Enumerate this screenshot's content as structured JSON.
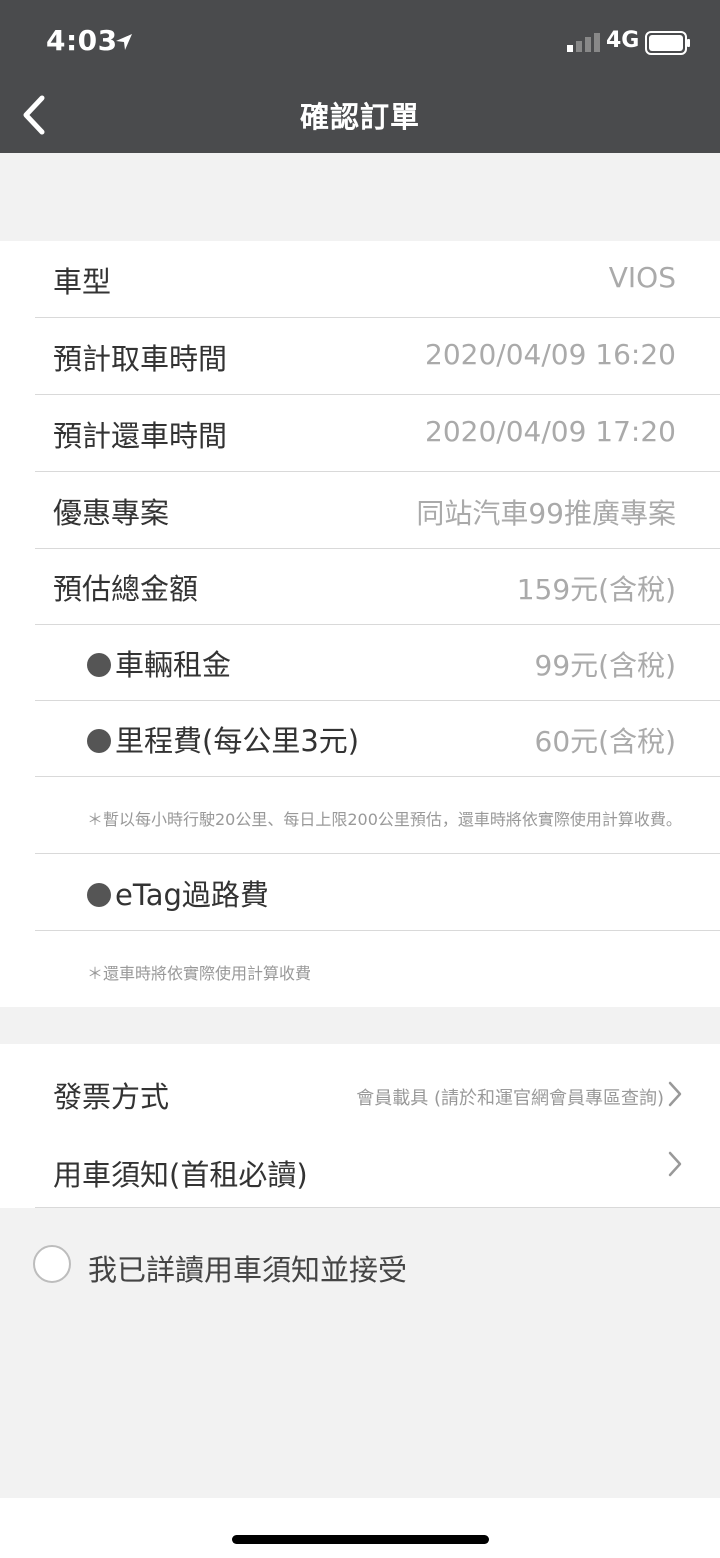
{
  "status_bar": {
    "time": "4:03",
    "network": "4G",
    "icons": [
      "location-arrow-icon",
      "signal-bars-icon",
      "battery-icon"
    ]
  },
  "nav": {
    "title": "確認訂單",
    "back_icon": "chevron-left-icon"
  },
  "order": {
    "rows": [
      {
        "label": "車型",
        "value": "VIOS"
      },
      {
        "label": "預計取車時間",
        "value": "2020/04/09 16:20"
      },
      {
        "label": "預計還車時間",
        "value": "2020/04/09 17:20"
      },
      {
        "label": "優惠專案",
        "value": "同站汽車99推廣專案"
      },
      {
        "label": "預估總金額",
        "value": "159元(含稅)"
      },
      {
        "label": "車輛租金",
        "value": "99元(含稅)"
      },
      {
        "label": "里程費(每公里3元)",
        "value": "60元(含稅)"
      }
    ],
    "mileage_note": "＊暫以每小時行駛20公里、每日上限200公里預估，還車時將依實際使用計算收費。",
    "etag_label": "eTag過路費",
    "etag_note": "＊還車時將依實際使用計算收費"
  },
  "options": {
    "invoice_label": "發票方式",
    "invoice_value": "會員載具 (請於和運官網會員專區查詢)",
    "notice_label": "用車須知(首租必讀)"
  },
  "agreement": {
    "text": "我已詳讀用車須知並接受",
    "checked": false
  },
  "colors": {
    "header_bg": "#4a4b4d",
    "page_bg": "#f2f2f2"
  }
}
